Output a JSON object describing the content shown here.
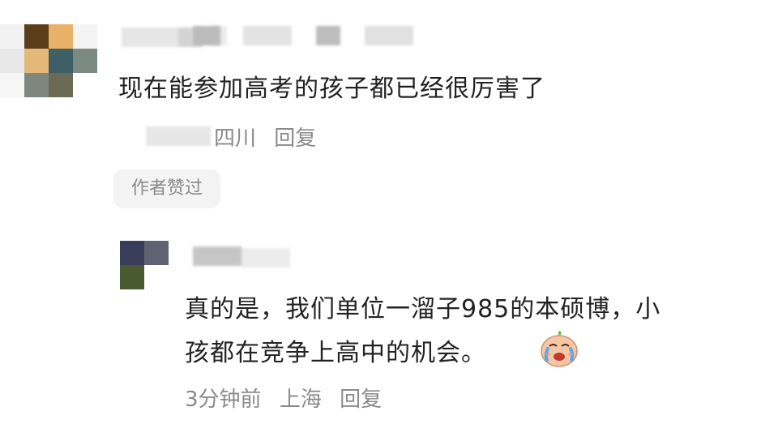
{
  "comment": {
    "text": "现在能参加高考的孩子都已经很厉害了",
    "location": "四川",
    "reply_label": "回复",
    "author_liked_badge": "作者赞过",
    "avatar_colors": [
      "#f2f2f2",
      "#5b3d1c",
      "#e9b067",
      "#f4f4f4",
      "#e8e8e8",
      "#e3b878",
      "#3d5f65",
      "#7a8a82",
      "#f6f6f6",
      "#7e877d",
      "#6a6a55",
      "#ffffff"
    ]
  },
  "reply": {
    "text_line1": "真的是，我们单位一溜子985的本硕博，小",
    "text_line2": "孩都在竞争上高中的机会。",
    "emoji": "crying-face-emoji",
    "time": "3分钟前",
    "location": "上海",
    "reply_label": "回复",
    "avatar_colors": [
      "#3a3d5a",
      "#5f6272",
      "#4a5a30",
      "#ffffff"
    ]
  }
}
